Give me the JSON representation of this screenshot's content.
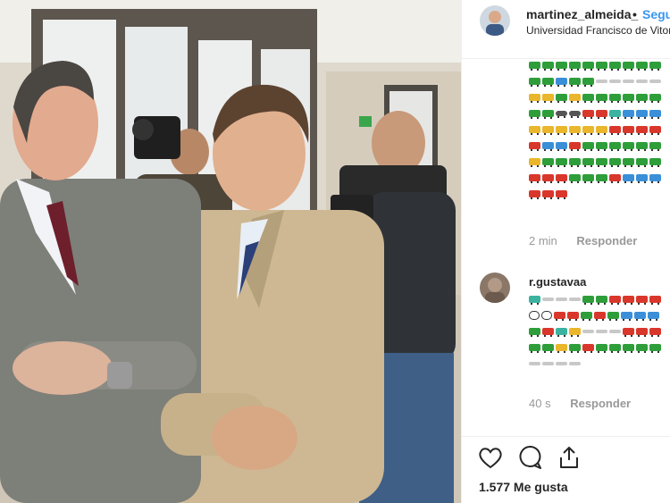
{
  "post": {
    "username": "martinez_almeida_",
    "dot": "•",
    "follow_label": "Seguir",
    "location": "Universidad Francisco de Vitoria"
  },
  "comments": [
    {
      "username": "",
      "time": "2 min",
      "reply_label": "Responder",
      "emoji_rows": [
        [
          "green",
          "green",
          "green",
          "green",
          "green",
          "green",
          "green",
          "green",
          "green",
          "green"
        ],
        [
          "green",
          "green",
          "blue",
          "green",
          "green",
          "plane",
          "plane",
          "plane",
          "plane",
          "plane"
        ],
        [
          "yellow",
          "yellow",
          "green",
          "yellow",
          "green",
          "green",
          "green",
          "green",
          "green",
          "green"
        ],
        [
          "green",
          "green",
          "moto",
          "moto",
          "red",
          "red",
          "teal",
          "blue",
          "blue",
          "blue"
        ],
        [
          "yellow",
          "yellow",
          "yellow",
          "yellow",
          "yellow",
          "yellow",
          "red",
          "red",
          "red",
          "red"
        ],
        [
          "red",
          "blue",
          "blue",
          "red",
          "green",
          "green",
          "green",
          "green",
          "green",
          "green"
        ],
        [
          "yellow",
          "green",
          "green",
          "green",
          "green",
          "green",
          "green",
          "green",
          "green",
          "green"
        ],
        [
          "red",
          "red",
          "red",
          "green",
          "green",
          "green",
          "red",
          "blue",
          "blue",
          "blue"
        ],
        [
          "red",
          "red",
          "red"
        ]
      ]
    },
    {
      "username": "r.gustavaa",
      "time": "40 s",
      "reply_label": "Responder",
      "emoji_rows": [
        [
          "teal",
          "plane",
          "plane",
          "plane",
          "green",
          "green",
          "red",
          "red",
          "red",
          "red"
        ],
        [
          "sign",
          "sign",
          "red",
          "red",
          "green",
          "red",
          "green",
          "blue",
          "blue",
          "blue"
        ],
        [
          "green",
          "red",
          "teal",
          "yellow",
          "plane",
          "plane",
          "plane",
          "red",
          "red",
          "red"
        ],
        [
          "green",
          "green",
          "yellow",
          "green",
          "red",
          "green",
          "green",
          "green",
          "green",
          "green"
        ],
        [
          "plane",
          "plane",
          "plane",
          "plane"
        ]
      ]
    }
  ],
  "actions": {
    "like_icon": "heart-icon",
    "comment_icon": "comment-icon",
    "share_icon": "share-icon"
  },
  "likes_text": "1.577 Me gusta",
  "colors": {
    "follow": "#3897f0",
    "emoji_green": "#2e9e3a",
    "emoji_red": "#d9372b",
    "emoji_yellow": "#e9b62c",
    "emoji_blue": "#3a8fd8",
    "emoji_teal": "#3bb3a0"
  }
}
